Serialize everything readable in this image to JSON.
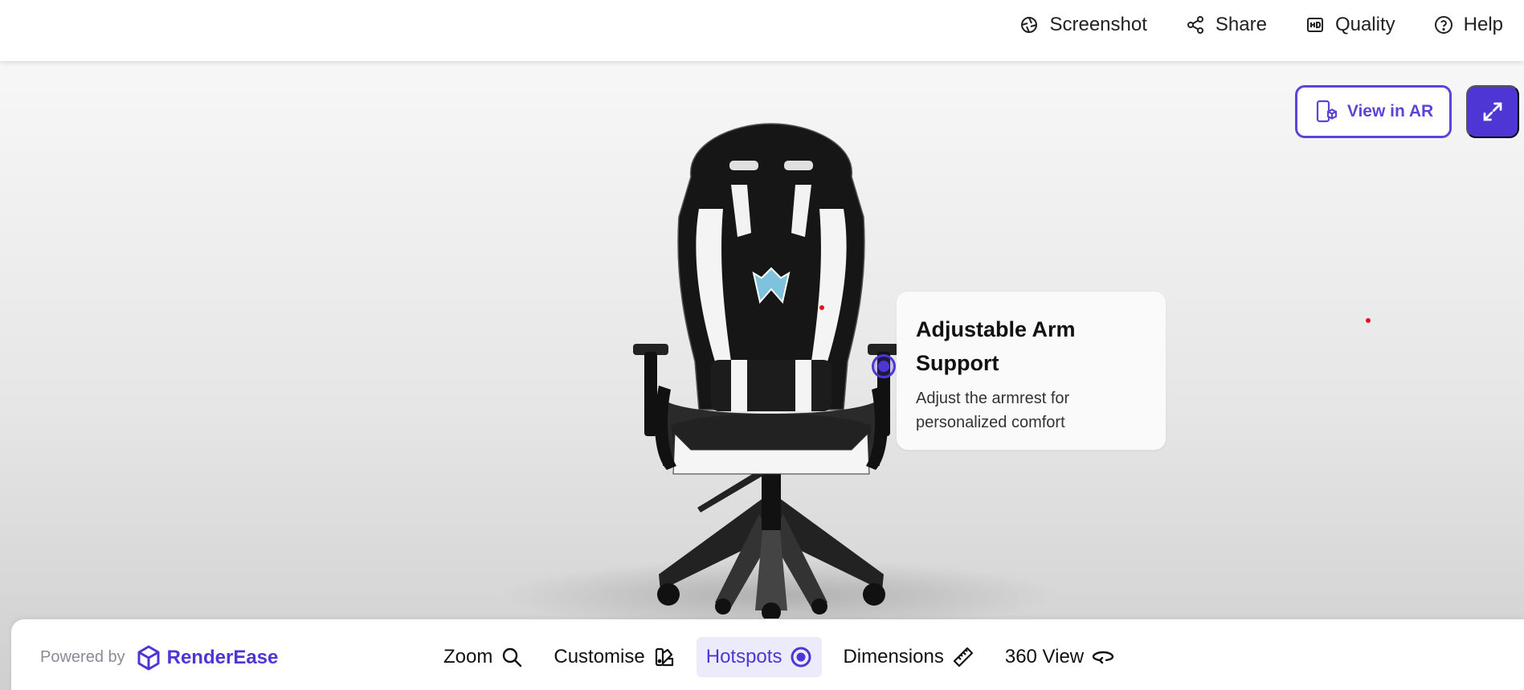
{
  "topbar": {
    "actions": [
      {
        "label": "Screenshot",
        "icon": "camera-aperture-icon"
      },
      {
        "label": "Share",
        "icon": "share-icon"
      },
      {
        "label": "Quality",
        "icon": "hd-icon"
      },
      {
        "label": "Help",
        "icon": "help-circle-icon"
      }
    ]
  },
  "viewer": {
    "ar_label": "View in AR",
    "hotspot": {
      "title": "Adjustable Arm Support",
      "description": "Adjust the armrest for personalized comfort"
    }
  },
  "footer": {
    "powered_by": "Powered by",
    "brand": "RenderEase",
    "tools": [
      {
        "label": "Zoom",
        "icon": "search-icon",
        "active": false
      },
      {
        "label": "Customise",
        "icon": "palette-icon",
        "active": false
      },
      {
        "label": "Hotspots",
        "icon": "target-icon",
        "active": true
      },
      {
        "label": "Dimensions",
        "icon": "ruler-icon",
        "active": false
      },
      {
        "label": "360 View",
        "icon": "rotate-360-icon",
        "active": false
      }
    ]
  },
  "colors": {
    "accent": "#4d36d4",
    "active_bg": "#ecebfb",
    "marker": "#e0141e"
  }
}
